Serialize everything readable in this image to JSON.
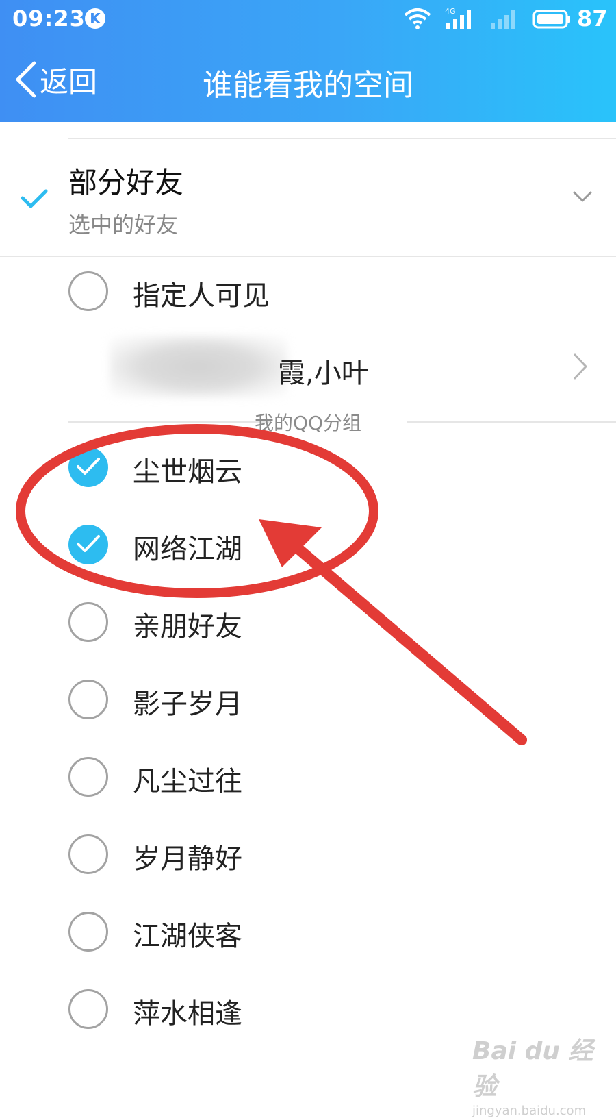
{
  "status_bar": {
    "time": "09:23",
    "app_badge": "K",
    "network_label": "4G",
    "battery": "87"
  },
  "nav": {
    "back_label": "返回",
    "title": "谁能看我的空间"
  },
  "partial_option": {
    "title": "部分好友",
    "subtitle": "选中的好友",
    "selected": true
  },
  "specified": {
    "label": "指定人可见",
    "names_visible": "霞,小叶"
  },
  "section": {
    "label": "我的QQ分组"
  },
  "groups": [
    {
      "label": "尘世烟云",
      "checked": true
    },
    {
      "label": "网络江湖",
      "checked": true
    },
    {
      "label": "亲朋好友",
      "checked": false
    },
    {
      "label": "影子岁月",
      "checked": false
    },
    {
      "label": "凡尘过往",
      "checked": false
    },
    {
      "label": "岁月静好",
      "checked": false
    },
    {
      "label": "江湖侠客",
      "checked": false
    },
    {
      "label": "萍水相逢",
      "checked": false
    }
  ],
  "colors": {
    "header_start": "#3f8ff3",
    "header_end": "#29c3fa",
    "accent": "#2dbcf0",
    "annotation": "#e33b36"
  },
  "watermark": {
    "main": "Bai du 经验",
    "sub": "jingyan.baidu.com"
  }
}
